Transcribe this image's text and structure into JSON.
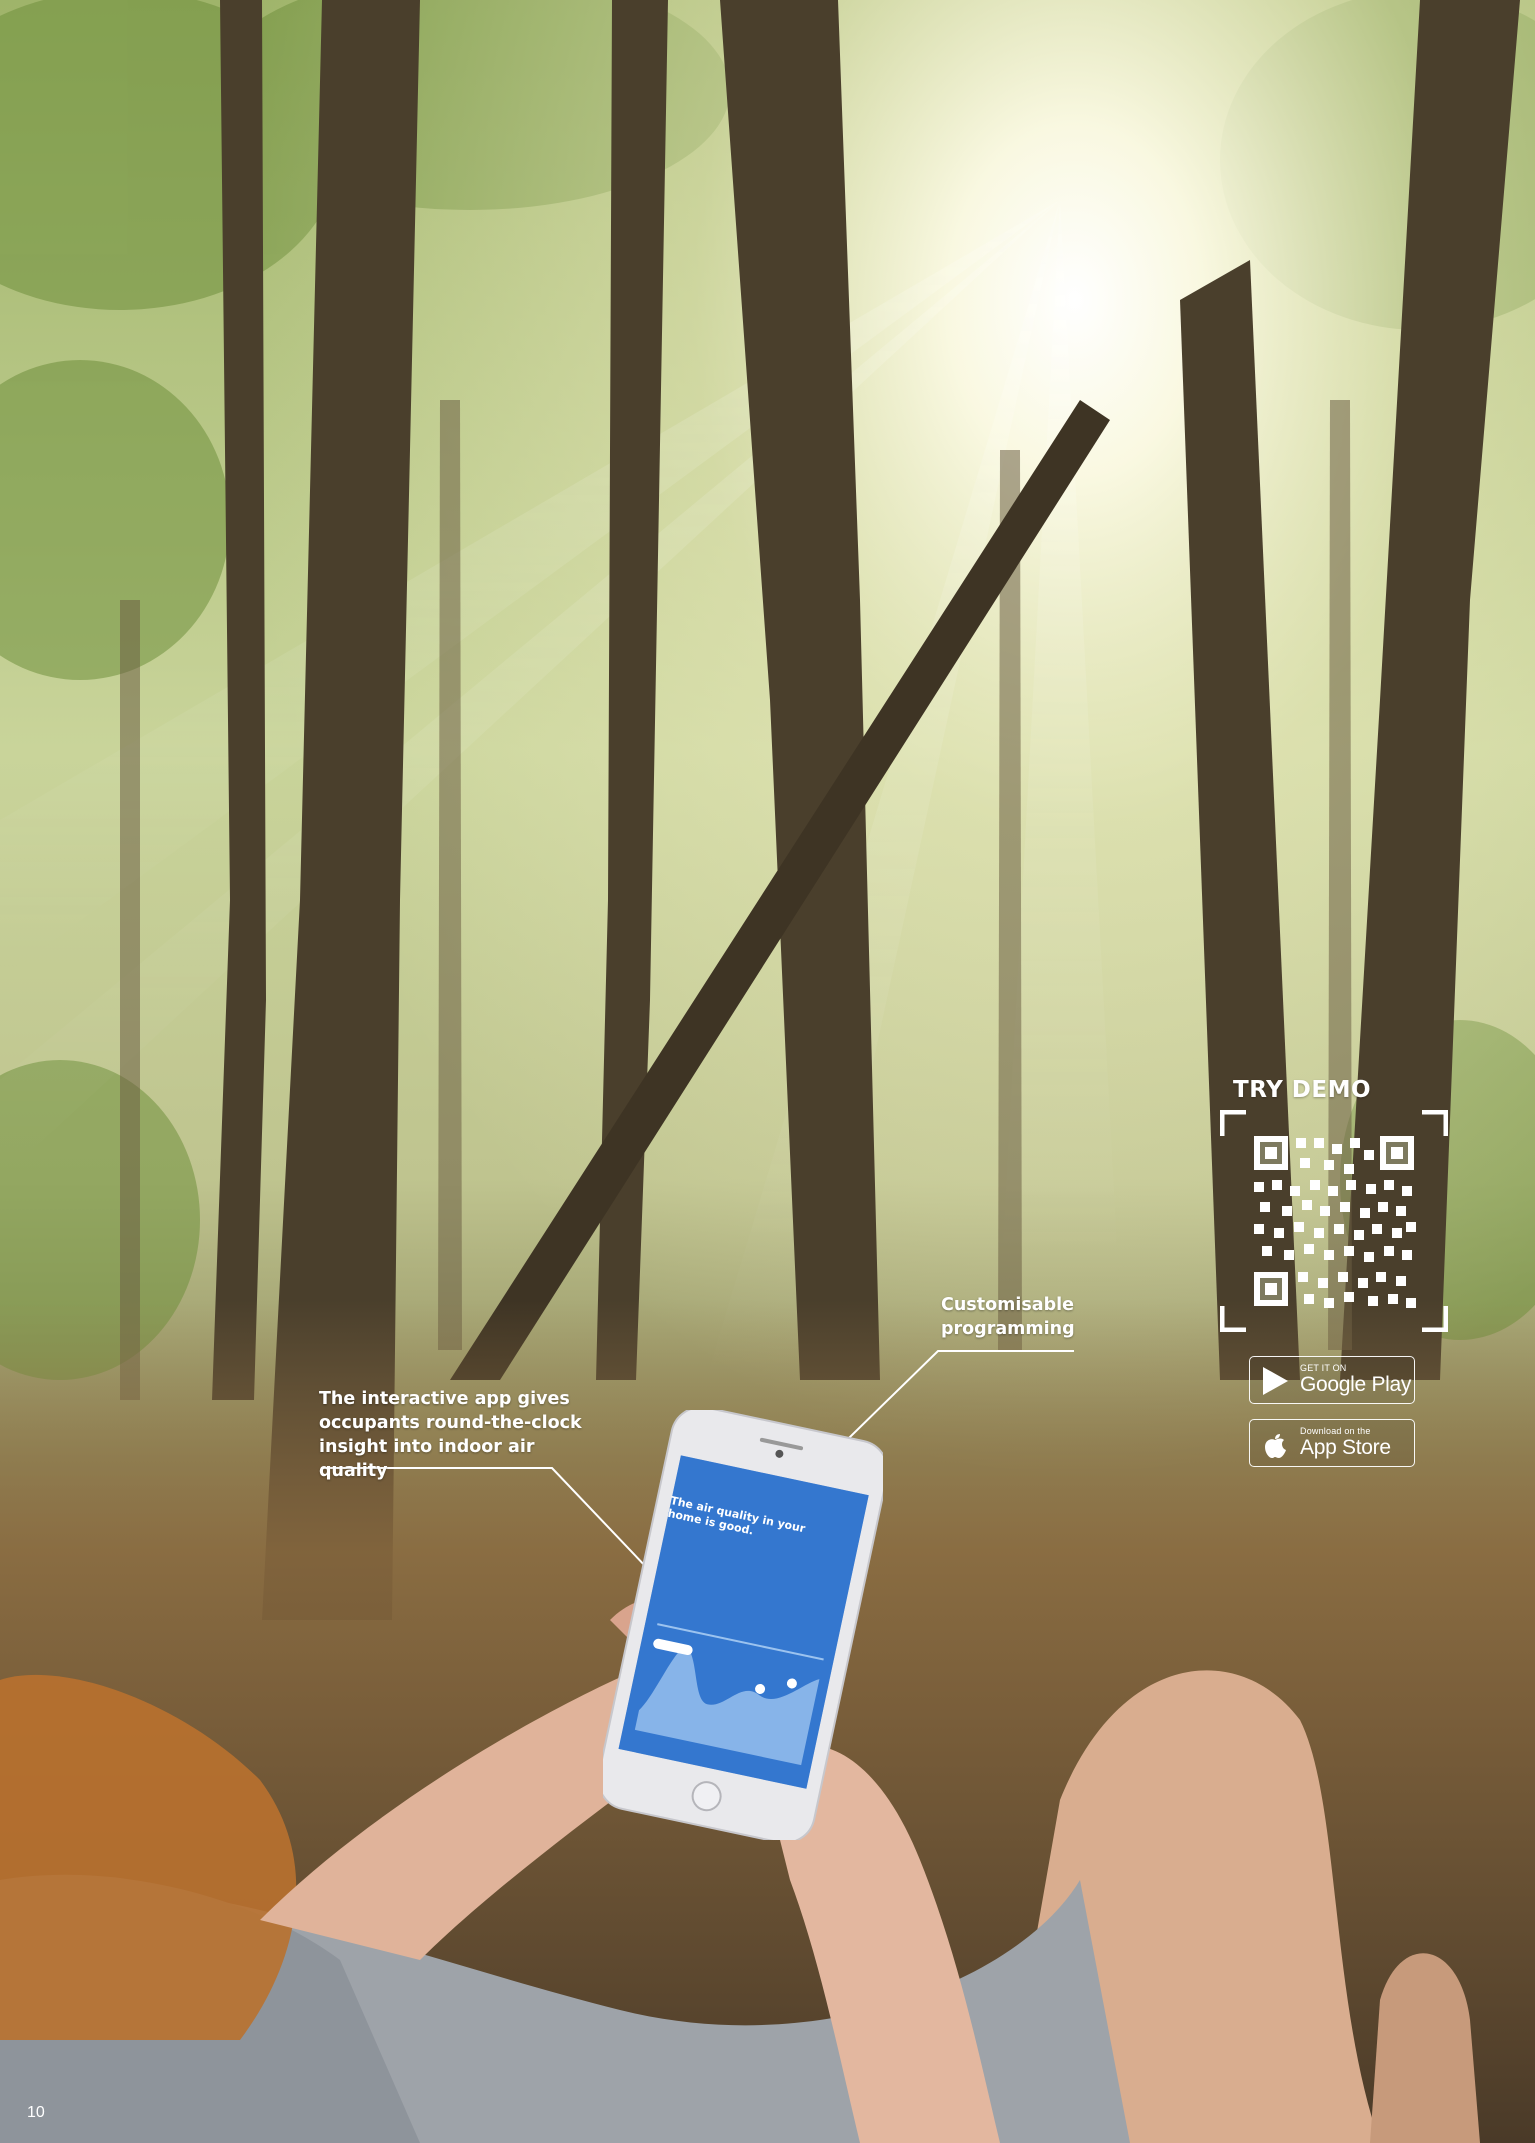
{
  "callouts": {
    "left": "The interactive app gives\noccupants round-the-clock\ninsight into indoor air quality",
    "right": "Customisable\nprogramming"
  },
  "try_demo": "TRY DEMO",
  "badges": {
    "google_play": {
      "small": "GET IT ON",
      "big": "Google Play"
    },
    "app_store": {
      "small": "Download on the",
      "big": "App Store"
    }
  },
  "phone_screen": {
    "headline": "The air quality in your home is good."
  },
  "page_number": "10",
  "colors": {
    "callout_text": "#ffffff",
    "phone_screen_blue": "#2f6fc8"
  }
}
